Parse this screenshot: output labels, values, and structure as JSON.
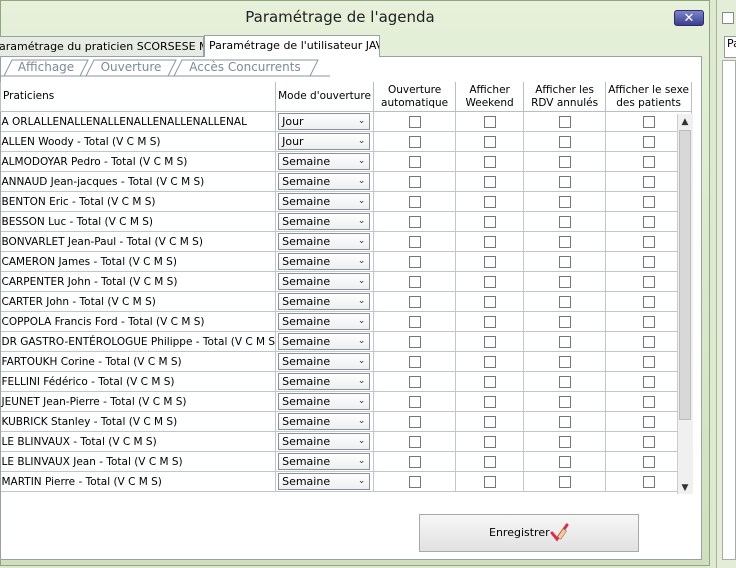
{
  "window": {
    "title": "Paramétrage de l'agenda",
    "close_glyph": "✕"
  },
  "right_window": {
    "tab_text": "Pa"
  },
  "outer_tabs": [
    {
      "label": "aramétrage du praticien SCORSESE Martin"
    },
    {
      "label": "Paramétrage de l'utilisateur JAVAD"
    }
  ],
  "sub_tabs": [
    {
      "label": "Affichage"
    },
    {
      "label": "Ouverture"
    },
    {
      "label": "Accès Concurrents"
    }
  ],
  "grid": {
    "headers": {
      "praticiens": "Praticiens",
      "mode": "Mode d'ouverture",
      "auto_l1": "Ouverture",
      "auto_l2": "automatique",
      "weekend_l1": "Afficher",
      "weekend_l2": "Weekend",
      "rdv_l1": "Afficher les",
      "rdv_l2": "RDV annulés",
      "sexe_l1": "Afficher le sexe",
      "sexe_l2": "des patients"
    },
    "rows": [
      {
        "name": "A ORLALLENALLENALLENALLENALLENALLENAL",
        "mode": "Jour"
      },
      {
        "name": "ALLEN Woody - Total (V C M S)",
        "mode": "Jour"
      },
      {
        "name": "ALMODOYAR Pedro - Total (V C M S)",
        "mode": "Semaine"
      },
      {
        "name": "ANNAUD Jean-jacques - Total (V C M S)",
        "mode": "Semaine"
      },
      {
        "name": "BENTON Eric - Total (V C M S)",
        "mode": "Semaine"
      },
      {
        "name": "BESSON Luc - Total (V C M S)",
        "mode": "Semaine"
      },
      {
        "name": "BONVARLET Jean-Paul - Total (V C M S)",
        "mode": "Semaine"
      },
      {
        "name": "CAMERON James - Total (V C M S)",
        "mode": "Semaine"
      },
      {
        "name": "CARPENTER John - Total (V C M S)",
        "mode": "Semaine"
      },
      {
        "name": "CARTER John - Total (V C M S)",
        "mode": "Semaine"
      },
      {
        "name": "COPPOLA Francis Ford - Total (V C M S)",
        "mode": "Semaine"
      },
      {
        "name": "DR GASTRO-ENTÉROLOGUE Philippe - Total (V C M S",
        "mode": "Semaine"
      },
      {
        "name": "FARTOUKH Corine - Total (V C M S)",
        "mode": "Semaine"
      },
      {
        "name": "FELLINI Fédérico - Total (V C M S)",
        "mode": "Semaine"
      },
      {
        "name": "JEUNET Jean-Pierre - Total (V C M S)",
        "mode": "Semaine"
      },
      {
        "name": "KUBRICK Stanley - Total (V C M S)",
        "mode": "Semaine"
      },
      {
        "name": "LE BLINVAUX - Total (V C M S)",
        "mode": "Semaine"
      },
      {
        "name": "LE BLINVAUX Jean - Total (V C M S)",
        "mode": "Semaine"
      },
      {
        "name": "MARTIN Pierre - Total (V C M S)",
        "mode": "Semaine"
      }
    ]
  },
  "save_button": {
    "label": "Enregistrer",
    "icon": "checkmark-pencil-icon"
  },
  "colors": {
    "frame_bg": "#dfe9d2",
    "close_button": "#3b3f8f",
    "save_icon": "#d9304a"
  }
}
